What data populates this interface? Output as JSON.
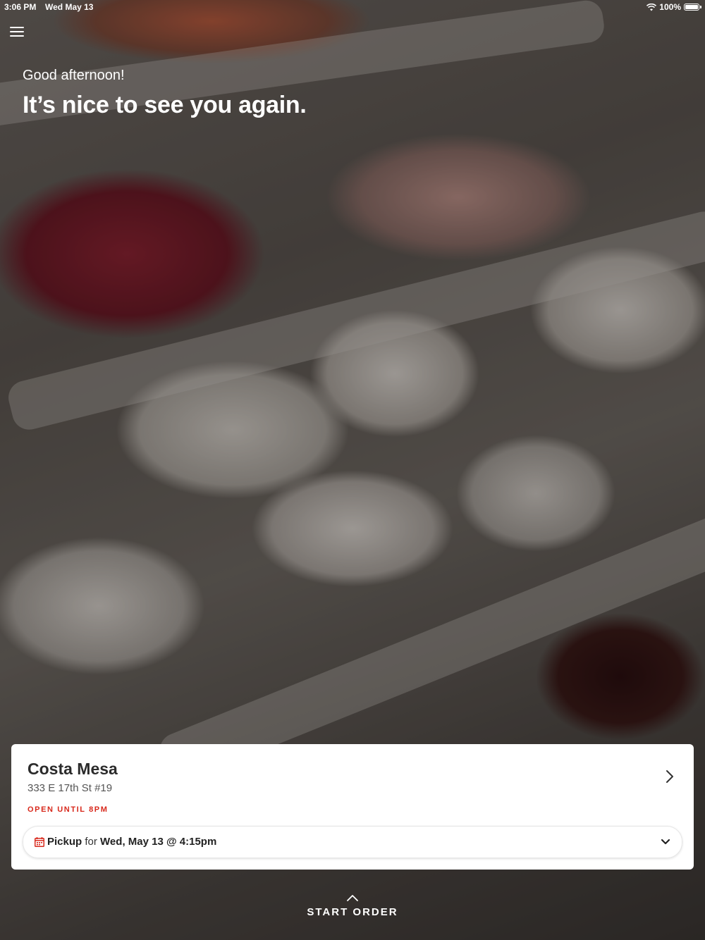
{
  "status_bar": {
    "time": "3:06 PM",
    "date": "Wed May 13",
    "battery": "100%"
  },
  "menu": {
    "icon": "hamburger-icon"
  },
  "hero": {
    "greeting": "Good afternoon!",
    "headline": "It’s nice to see you again."
  },
  "location": {
    "name": "Costa Mesa",
    "address": "333 E 17th St #19",
    "hours": "OPEN UNTIL 8PM",
    "hours_color": "#d8291c"
  },
  "pickup": {
    "mode": "Pickup",
    "connector": "for",
    "datetime": "Wed, May 13 @ 4:15pm",
    "icon": "calendar-icon",
    "icon_color": "#d8291c"
  },
  "start_order": {
    "label": "START ORDER"
  }
}
